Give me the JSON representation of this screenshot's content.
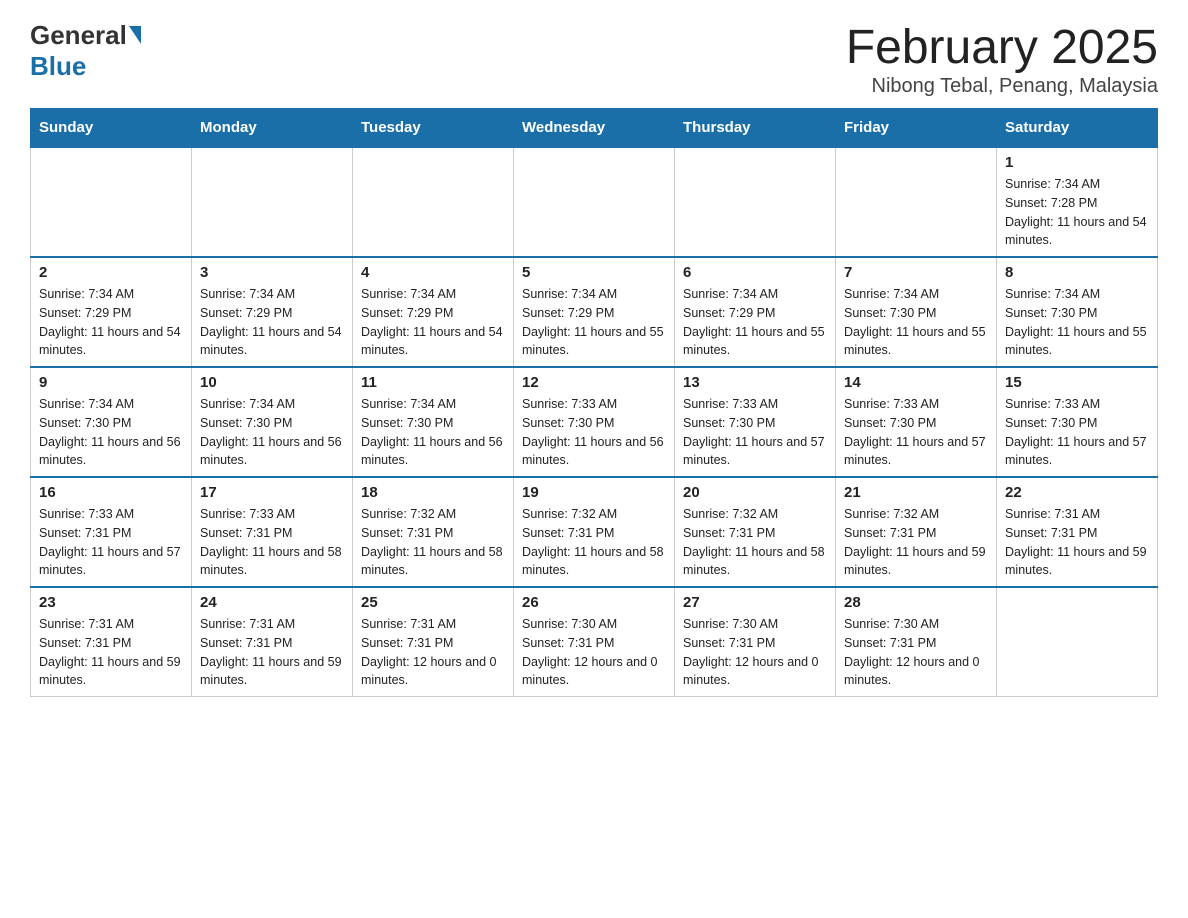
{
  "header": {
    "logo_general": "General",
    "logo_blue": "Blue",
    "month_title": "February 2025",
    "location": "Nibong Tebal, Penang, Malaysia"
  },
  "weekdays": [
    "Sunday",
    "Monday",
    "Tuesday",
    "Wednesday",
    "Thursday",
    "Friday",
    "Saturday"
  ],
  "weeks": [
    [
      {
        "day": "",
        "sunrise": "",
        "sunset": "",
        "daylight": ""
      },
      {
        "day": "",
        "sunrise": "",
        "sunset": "",
        "daylight": ""
      },
      {
        "day": "",
        "sunrise": "",
        "sunset": "",
        "daylight": ""
      },
      {
        "day": "",
        "sunrise": "",
        "sunset": "",
        "daylight": ""
      },
      {
        "day": "",
        "sunrise": "",
        "sunset": "",
        "daylight": ""
      },
      {
        "day": "",
        "sunrise": "",
        "sunset": "",
        "daylight": ""
      },
      {
        "day": "1",
        "sunrise": "Sunrise: 7:34 AM",
        "sunset": "Sunset: 7:28 PM",
        "daylight": "Daylight: 11 hours and 54 minutes."
      }
    ],
    [
      {
        "day": "2",
        "sunrise": "Sunrise: 7:34 AM",
        "sunset": "Sunset: 7:29 PM",
        "daylight": "Daylight: 11 hours and 54 minutes."
      },
      {
        "day": "3",
        "sunrise": "Sunrise: 7:34 AM",
        "sunset": "Sunset: 7:29 PM",
        "daylight": "Daylight: 11 hours and 54 minutes."
      },
      {
        "day": "4",
        "sunrise": "Sunrise: 7:34 AM",
        "sunset": "Sunset: 7:29 PM",
        "daylight": "Daylight: 11 hours and 54 minutes."
      },
      {
        "day": "5",
        "sunrise": "Sunrise: 7:34 AM",
        "sunset": "Sunset: 7:29 PM",
        "daylight": "Daylight: 11 hours and 55 minutes."
      },
      {
        "day": "6",
        "sunrise": "Sunrise: 7:34 AM",
        "sunset": "Sunset: 7:29 PM",
        "daylight": "Daylight: 11 hours and 55 minutes."
      },
      {
        "day": "7",
        "sunrise": "Sunrise: 7:34 AM",
        "sunset": "Sunset: 7:30 PM",
        "daylight": "Daylight: 11 hours and 55 minutes."
      },
      {
        "day": "8",
        "sunrise": "Sunrise: 7:34 AM",
        "sunset": "Sunset: 7:30 PM",
        "daylight": "Daylight: 11 hours and 55 minutes."
      }
    ],
    [
      {
        "day": "9",
        "sunrise": "Sunrise: 7:34 AM",
        "sunset": "Sunset: 7:30 PM",
        "daylight": "Daylight: 11 hours and 56 minutes."
      },
      {
        "day": "10",
        "sunrise": "Sunrise: 7:34 AM",
        "sunset": "Sunset: 7:30 PM",
        "daylight": "Daylight: 11 hours and 56 minutes."
      },
      {
        "day": "11",
        "sunrise": "Sunrise: 7:34 AM",
        "sunset": "Sunset: 7:30 PM",
        "daylight": "Daylight: 11 hours and 56 minutes."
      },
      {
        "day": "12",
        "sunrise": "Sunrise: 7:33 AM",
        "sunset": "Sunset: 7:30 PM",
        "daylight": "Daylight: 11 hours and 56 minutes."
      },
      {
        "day": "13",
        "sunrise": "Sunrise: 7:33 AM",
        "sunset": "Sunset: 7:30 PM",
        "daylight": "Daylight: 11 hours and 57 minutes."
      },
      {
        "day": "14",
        "sunrise": "Sunrise: 7:33 AM",
        "sunset": "Sunset: 7:30 PM",
        "daylight": "Daylight: 11 hours and 57 minutes."
      },
      {
        "day": "15",
        "sunrise": "Sunrise: 7:33 AM",
        "sunset": "Sunset: 7:30 PM",
        "daylight": "Daylight: 11 hours and 57 minutes."
      }
    ],
    [
      {
        "day": "16",
        "sunrise": "Sunrise: 7:33 AM",
        "sunset": "Sunset: 7:31 PM",
        "daylight": "Daylight: 11 hours and 57 minutes."
      },
      {
        "day": "17",
        "sunrise": "Sunrise: 7:33 AM",
        "sunset": "Sunset: 7:31 PM",
        "daylight": "Daylight: 11 hours and 58 minutes."
      },
      {
        "day": "18",
        "sunrise": "Sunrise: 7:32 AM",
        "sunset": "Sunset: 7:31 PM",
        "daylight": "Daylight: 11 hours and 58 minutes."
      },
      {
        "day": "19",
        "sunrise": "Sunrise: 7:32 AM",
        "sunset": "Sunset: 7:31 PM",
        "daylight": "Daylight: 11 hours and 58 minutes."
      },
      {
        "day": "20",
        "sunrise": "Sunrise: 7:32 AM",
        "sunset": "Sunset: 7:31 PM",
        "daylight": "Daylight: 11 hours and 58 minutes."
      },
      {
        "day": "21",
        "sunrise": "Sunrise: 7:32 AM",
        "sunset": "Sunset: 7:31 PM",
        "daylight": "Daylight: 11 hours and 59 minutes."
      },
      {
        "day": "22",
        "sunrise": "Sunrise: 7:31 AM",
        "sunset": "Sunset: 7:31 PM",
        "daylight": "Daylight: 11 hours and 59 minutes."
      }
    ],
    [
      {
        "day": "23",
        "sunrise": "Sunrise: 7:31 AM",
        "sunset": "Sunset: 7:31 PM",
        "daylight": "Daylight: 11 hours and 59 minutes."
      },
      {
        "day": "24",
        "sunrise": "Sunrise: 7:31 AM",
        "sunset": "Sunset: 7:31 PM",
        "daylight": "Daylight: 11 hours and 59 minutes."
      },
      {
        "day": "25",
        "sunrise": "Sunrise: 7:31 AM",
        "sunset": "Sunset: 7:31 PM",
        "daylight": "Daylight: 12 hours and 0 minutes."
      },
      {
        "day": "26",
        "sunrise": "Sunrise: 7:30 AM",
        "sunset": "Sunset: 7:31 PM",
        "daylight": "Daylight: 12 hours and 0 minutes."
      },
      {
        "day": "27",
        "sunrise": "Sunrise: 7:30 AM",
        "sunset": "Sunset: 7:31 PM",
        "daylight": "Daylight: 12 hours and 0 minutes."
      },
      {
        "day": "28",
        "sunrise": "Sunrise: 7:30 AM",
        "sunset": "Sunset: 7:31 PM",
        "daylight": "Daylight: 12 hours and 0 minutes."
      },
      {
        "day": "",
        "sunrise": "",
        "sunset": "",
        "daylight": ""
      }
    ]
  ]
}
